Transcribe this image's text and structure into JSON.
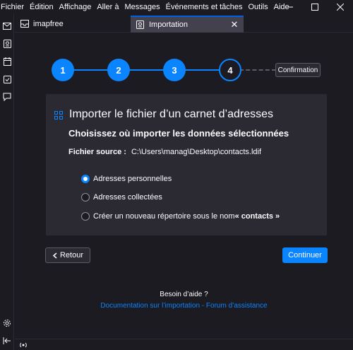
{
  "menubar": {
    "items": [
      "Fichier",
      "Édition",
      "Affichage",
      "Aller à",
      "Messages",
      "Événements et tâches",
      "Outils",
      "Aide"
    ]
  },
  "window_controls": {
    "minimize": "—",
    "maximize": "☐",
    "close": "✕"
  },
  "spaces": {
    "items": [
      "mail-icon",
      "address-book-icon",
      "calendar-icon",
      "tasks-icon",
      "chat-icon"
    ],
    "settings": "settings-icon",
    "collapse": "collapse-icon"
  },
  "tabs": [
    {
      "label": "imapfree",
      "icon": "folder-icon",
      "active": false
    },
    {
      "label": "Importation",
      "icon": "import-icon",
      "active": true
    }
  ],
  "tab_close": "✕",
  "stepper": {
    "steps": [
      "1",
      "2",
      "3",
      "4"
    ],
    "current": 4,
    "final_label": "Confirmation"
  },
  "panel": {
    "title": "Importer le fichier d’un carnet d’adresses",
    "subtitle": "Choisissez où importer les données sélectionnées",
    "source_label": "Fichier source :",
    "source_value": "C:\\Users\\manag\\Desktop\\contacts.ldif",
    "options": [
      {
        "label": "Adresses personnelles",
        "checked": true
      },
      {
        "label": "Adresses collectées",
        "checked": false
      },
      {
        "label_prefix": "Créer un nouveau répertoire sous le nom ",
        "label_bold": "« contacts »",
        "checked": false
      }
    ]
  },
  "buttons": {
    "back": "Retour",
    "continue": "Continuer"
  },
  "help": {
    "question": "Besoin d’aide ?",
    "doc_link": "Documentation sur l’importation",
    "separator": " - ",
    "forum_link": "Forum d’assistance"
  },
  "status": {
    "icon": "online-status-icon"
  },
  "colors": {
    "accent": "#0a84ff",
    "background": "#1c1b22",
    "panel": "#2b2a33"
  }
}
